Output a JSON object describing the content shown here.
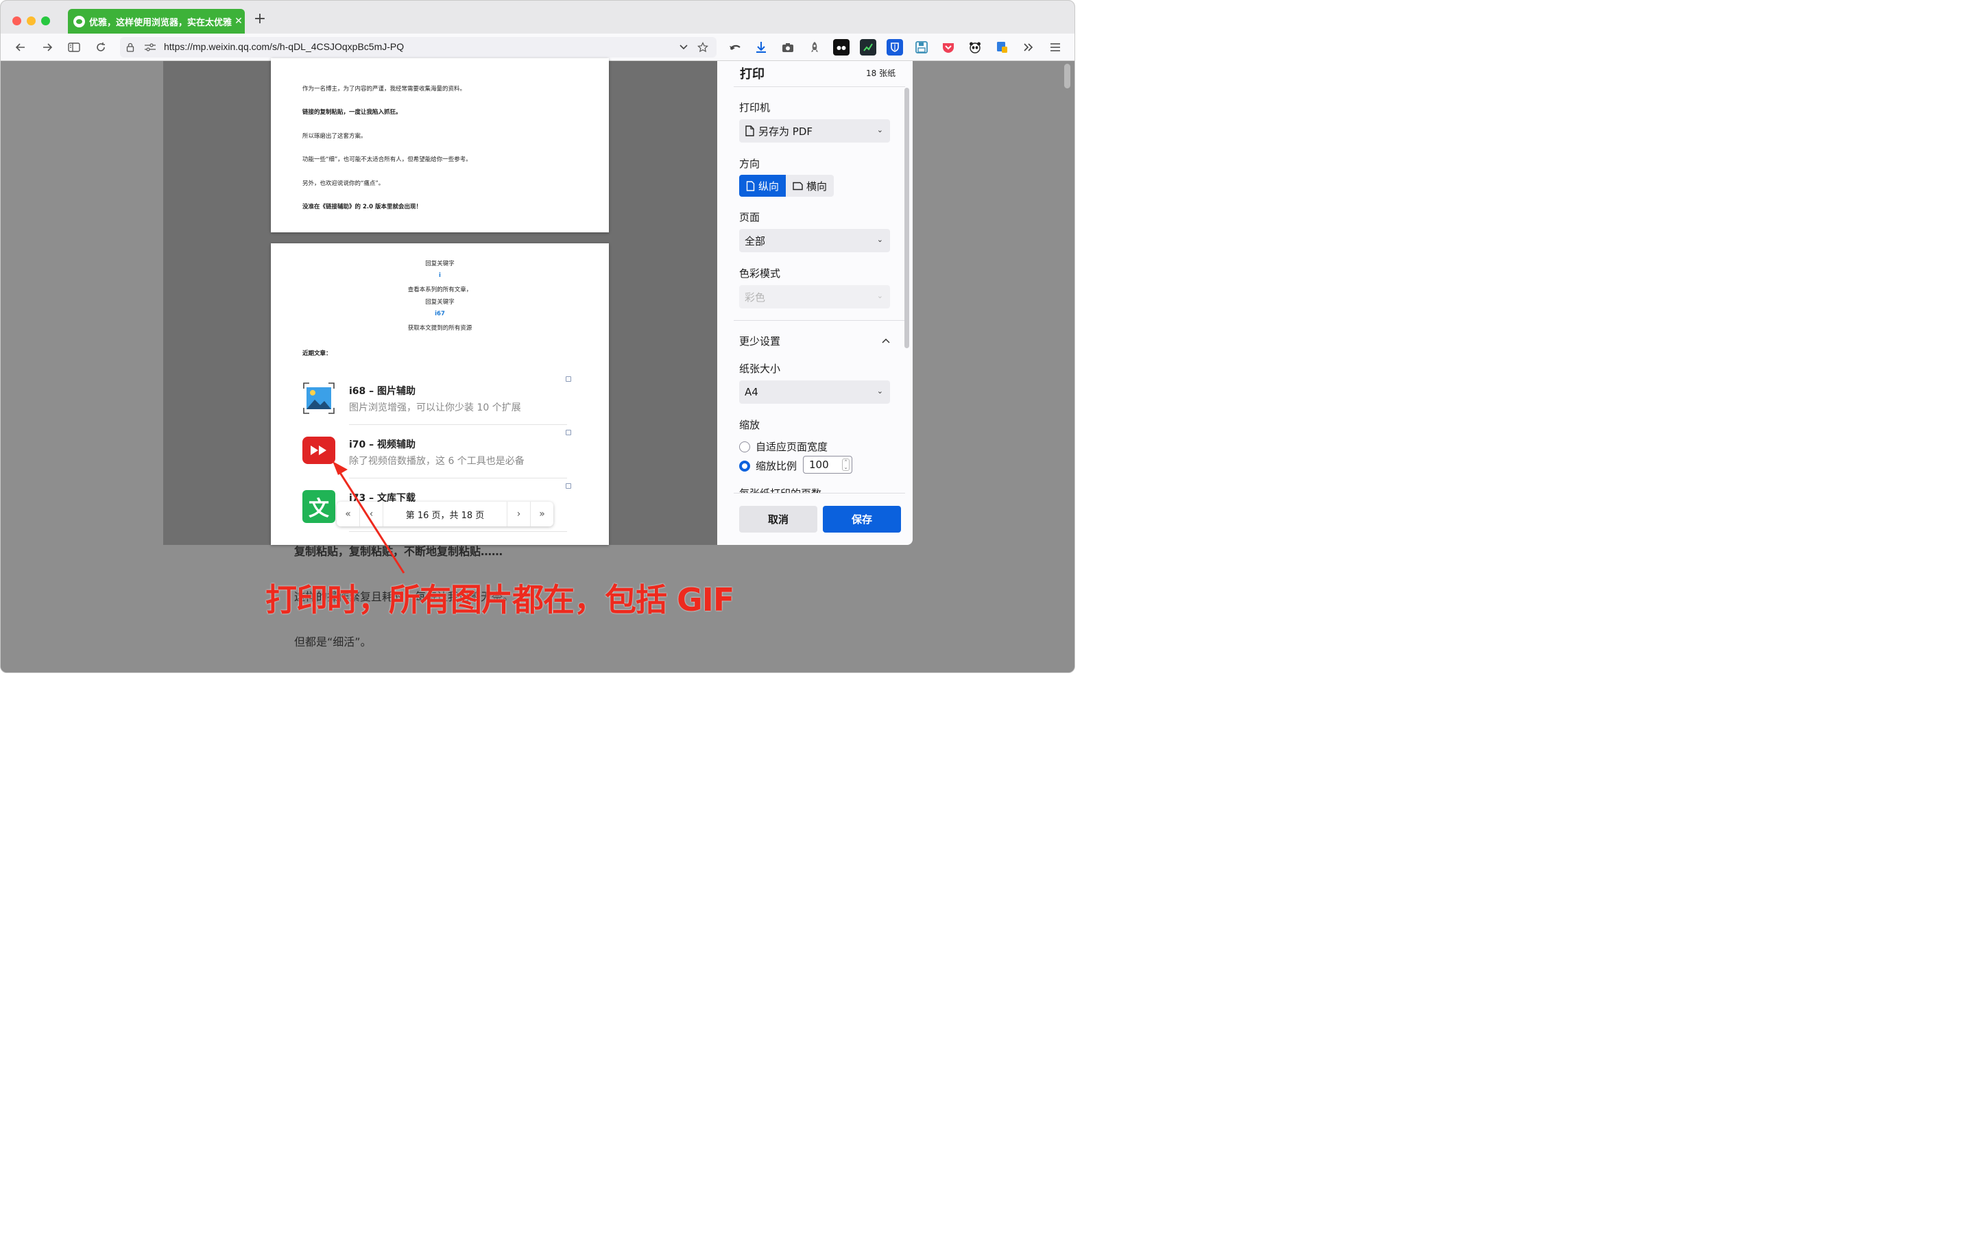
{
  "browser": {
    "tab_title": "优雅，这样使用浏览器，实在太优雅了",
    "tab_close": "✕",
    "new_tab": "+",
    "url": "https://mp.weixin.qq.com/s/h-qDL_4CSJOqxpBc5mJ-PQ"
  },
  "background_doc": {
    "line1": "复制粘贴，复制粘贴，不断地复制粘贴……",
    "line2": "这样的操作繁复且耗时，每每让我倍感无奈。",
    "line3": "但都是“细活”。"
  },
  "preview": {
    "page1_lines": [
      "作为一名博主，为了内容的严谨，我经常需要收集海量的资料。",
      "链接的复制粘贴，一度让我陷入抓狂。",
      "所以琢磨出了这套方案。",
      "功能一些“细”，也可能不太适合所有人，但希望能给你一些参考。",
      "另外，也欢迎说说你的“痛点”。",
      "没准在《链接辅助》的 2.0 版本里就会出现！"
    ],
    "reply_lines": [
      "回复关键字",
      "i",
      "查看本系列的所有文章，",
      "回复关键字",
      "i67",
      "获取本文提到的所有资源"
    ],
    "recent_label": "近期文章：",
    "articles": [
      {
        "title": "i68 – 图片辅助",
        "desc": "图片浏览增强，可以让你少装 10 个扩展"
      },
      {
        "title": "i70 – 视频辅助",
        "desc": "除了视频倍数播放，这 6 个工具也是必备"
      },
      {
        "title": "i73 – 文库下载",
        "desc": ""
      }
    ],
    "pager": {
      "first": "«",
      "prev": "‹",
      "status": "第 16 页，共 18 页",
      "next": "›",
      "last": "»"
    }
  },
  "print_panel": {
    "title": "打印",
    "sheets": "18 张纸",
    "printer_label": "打印机",
    "printer_value": "另存为 PDF",
    "orientation_label": "方向",
    "portrait": "纵向",
    "landscape": "横向",
    "pages_label": "页面",
    "pages_value": "全部",
    "color_label": "色彩模式",
    "color_value": "彩色",
    "fewer_settings": "更少设置",
    "paper_label": "纸张大小",
    "paper_value": "A4",
    "scale_label": "缩放",
    "fit_width": "自适应页面宽度",
    "scale_option": "缩放比例",
    "scale_value": "100",
    "pages_per_sheet": "每张纸打印的页数",
    "cancel": "取消",
    "save": "保存"
  },
  "annotation": "打印时，所有图片都在，包括 GIF",
  "colors": {
    "tab_green": "#3db239",
    "accent_blue": "#0b61dd",
    "annotation_red": "#ee2a1e"
  }
}
